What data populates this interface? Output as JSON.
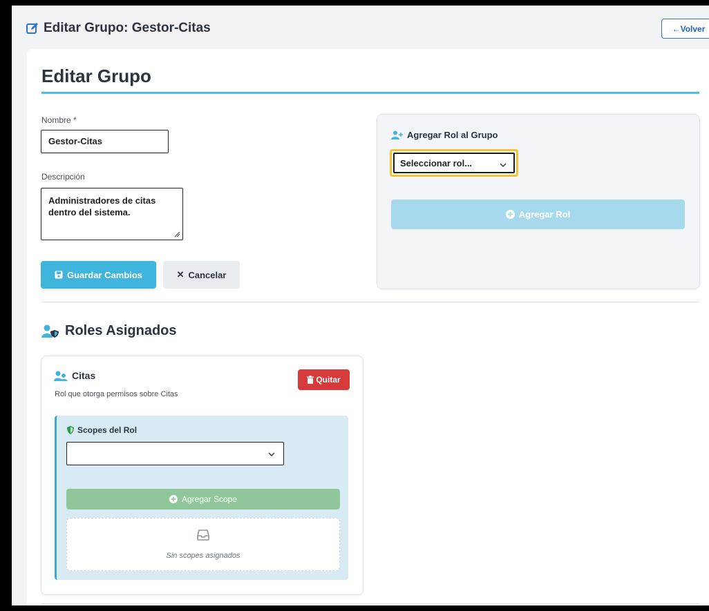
{
  "header": {
    "title": "Editar Grupo: Gestor-Citas",
    "title_icon": "edit-square-icon",
    "back_label": "←Volver"
  },
  "form": {
    "card_title": "Editar Grupo",
    "name_label": "Nombre *",
    "name_value": "Gestor-Citas",
    "description_label": "Descripción",
    "description_value": "Administradores de citas dentro del sistema.",
    "save_label": "Guardar Cambios",
    "save_icon": "floppy-disk-icon",
    "cancel_label": "Cancelar",
    "cancel_icon": "x-icon"
  },
  "add_role": {
    "title": "Agregar Rol al Grupo",
    "title_icon": "user-plus-icon",
    "select_value": "Seleccionar rol...",
    "button_label": "Agregar Rol",
    "button_icon": "plus-circle-icon"
  },
  "assigned_roles": {
    "title": "Roles Asignados",
    "title_icon": "users-shield-icon",
    "roles": [
      {
        "name": "Citas",
        "description": "Rol que otorga permisos sobre Citas",
        "remove_label": "Quitar",
        "remove_icon": "trash-icon",
        "scopes_title": "Scopes del Rol",
        "scopes_icon": "shield-icon",
        "scope_select_value": "",
        "add_scope_label": "Agregar Scope",
        "empty_label": "Sin scopes asignados",
        "empty_icon": "inbox-icon"
      }
    ]
  },
  "colors": {
    "primary": "#3fb4dc",
    "danger": "#d63a3a",
    "success_muted": "#8fc79a",
    "focus_ring": "#f3c232",
    "accent_rule": "#4bbde3",
    "link_blue": "#1f5fc9"
  }
}
